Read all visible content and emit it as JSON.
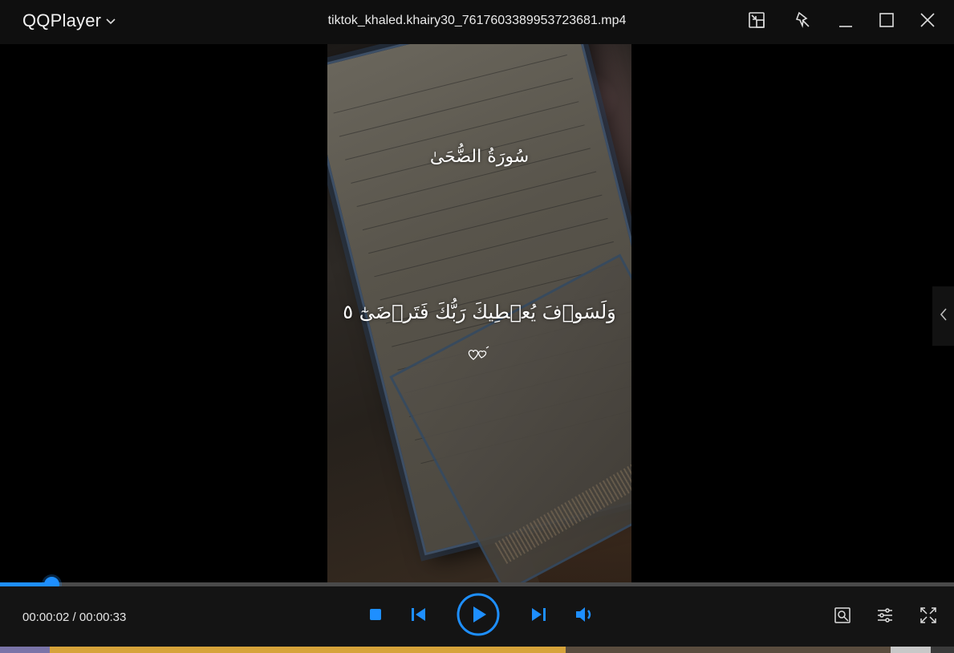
{
  "app": {
    "name": "QQPlayer",
    "file_title": "tiktok_khaled.khairy30_7617603389953723681.mp4"
  },
  "video": {
    "surah_title": "سُورَةُ الضُّحَىٰ",
    "verse_text": "وَلَسَوۡفَ يُعۡطِيكَ رَبُّكَ فَتَرۡضَىٰٓ ٥"
  },
  "playback": {
    "current_time": "00:00:02",
    "separator": " / ",
    "total_time": "00:00:33",
    "progress_fraction": 0.054,
    "state": "paused"
  },
  "colors": {
    "accent": "#1e8fff",
    "titlebar": "#0f0f0f",
    "controlbar": "#141414"
  },
  "icons": {
    "window": [
      "mini-mode-icon",
      "pin-icon",
      "minimize-icon",
      "maximize-icon",
      "close-icon"
    ],
    "controls": [
      "stop-icon",
      "previous-icon",
      "play-icon",
      "next-icon",
      "volume-icon"
    ],
    "right": [
      "screenshot-icon",
      "settings-icon",
      "fullscreen-icon"
    ]
  }
}
